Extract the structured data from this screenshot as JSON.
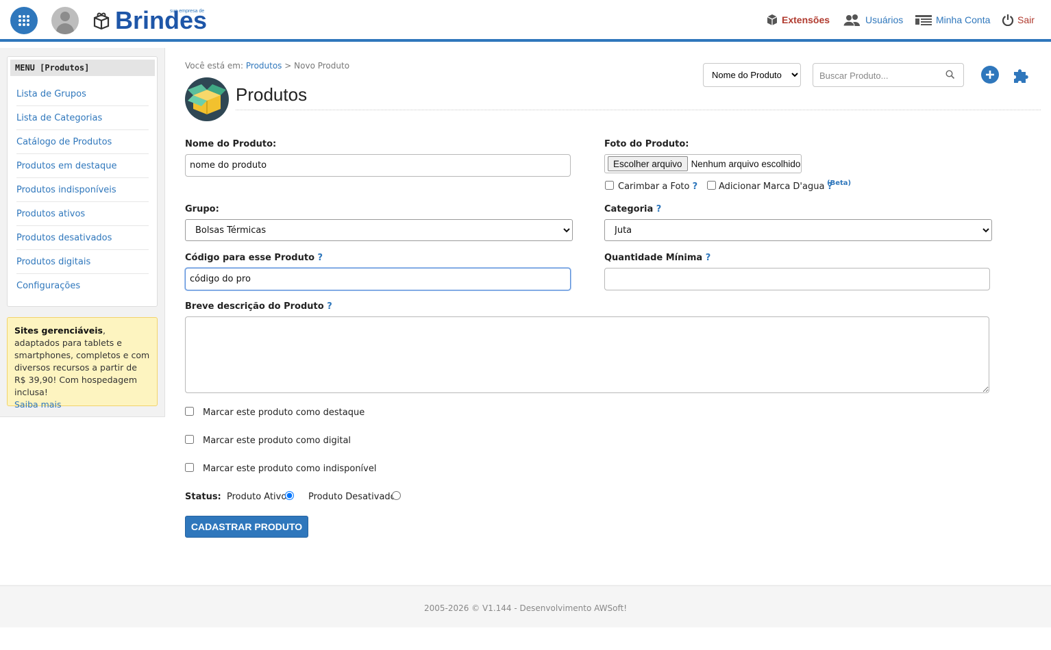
{
  "header": {
    "logo_text": "Brindes",
    "logo_tagline": "sua empresa de",
    "nav": {
      "extensions": "Extensões",
      "users": "Usuários",
      "account": "Minha Conta",
      "logout": "Sair"
    },
    "colors": {
      "brand": "#2f77bc",
      "alert": "#b03a2e"
    }
  },
  "sidebar": {
    "title": "MENU [Produtos]",
    "items": [
      {
        "label": "Lista de Grupos"
      },
      {
        "label": "Lista de Categorias"
      },
      {
        "label": "Catálogo de Produtos"
      },
      {
        "label": "Produtos em destaque"
      },
      {
        "label": "Produtos indisponíveis"
      },
      {
        "label": "Produtos ativos"
      },
      {
        "label": "Produtos desativados"
      },
      {
        "label": "Produtos digitais"
      },
      {
        "label": "Configurações"
      }
    ],
    "promo": {
      "bold": "Sites gerenciáveis",
      "text": ", adaptados para tablets e smartphones, completos e com diversos recursos a partir de R$ 39,90! Com hospedagem inclusa!",
      "link": "Saiba mais"
    }
  },
  "breadcrumb": {
    "prefix": "Você está em:",
    "link": "Produtos",
    "separator": ">",
    "current": "Novo Produto"
  },
  "page": {
    "title": "Produtos"
  },
  "search": {
    "field_select": "Nome do Produto",
    "placeholder": "Buscar Produto..."
  },
  "form": {
    "name": {
      "label": "Nome do Produto:",
      "value": "nome do produto"
    },
    "photo": {
      "label": "Foto do Produto:",
      "button": "Escolher arquivo",
      "status": "Nenhum arquivo escolhido",
      "stamp_label": "Carimbar a Foto",
      "watermark_label": "Adicionar Marca D'agua",
      "beta": "(Beta)",
      "stamp_checked": false,
      "watermark_checked": false
    },
    "group": {
      "label": "Grupo:",
      "value": "Bolsas Térmicas"
    },
    "category": {
      "label": "Categoria",
      "value": "Juta"
    },
    "code": {
      "label": "Código para esse Produto",
      "value": "código do pro"
    },
    "min_qty": {
      "label": "Quantidade Mínima",
      "value": ""
    },
    "description": {
      "label": "Breve descrição do Produto",
      "value": ""
    },
    "help_mark": "?",
    "flags": [
      {
        "label": "Marcar este produto como destaque",
        "checked": false
      },
      {
        "label": "Marcar este produto como digital",
        "checked": false
      },
      {
        "label": "Marcar este produto como indisponível",
        "checked": false
      }
    ],
    "status": {
      "label": "Status:",
      "active": "Produto Ativo",
      "inactive": "Produto Desativado",
      "selected": "active"
    },
    "submit": "CADASTRAR PRODUTO"
  },
  "footer": {
    "text": "2005-2026 © V1.144 - Desenvolvimento AWSoft!"
  }
}
